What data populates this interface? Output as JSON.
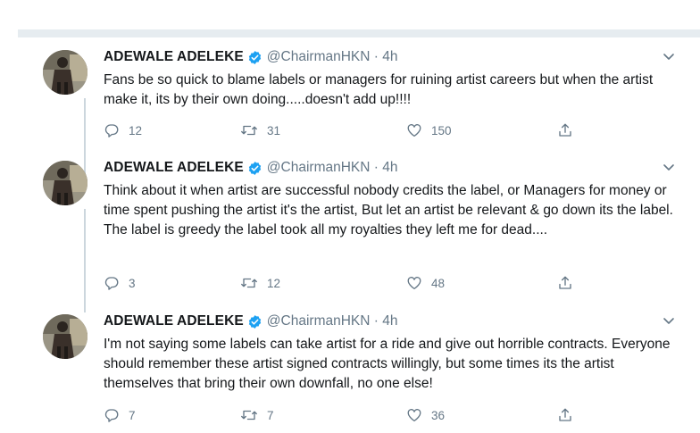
{
  "tweets": [
    {
      "name": "ADEWALE ADELEKE",
      "meta": "@ChairmanHKN · 4h",
      "text": "Fans be so quick to blame labels or managers for ruining artist careers but when the artist make it, its by their own doing.....doesn't add up!!!!",
      "replies": "12",
      "retweets": "31",
      "likes": "150"
    },
    {
      "name": "ADEWALE ADELEKE",
      "meta": "@ChairmanHKN · 4h",
      "text": "Think about it when artist are successful nobody credits the label, or Managers for money or time spent pushing the artist it's the artist, But let an artist be relevant & go down its the label. The label is greedy the label took all my royalties they left me for dead....",
      "replies": "3",
      "retweets": "12",
      "likes": "48"
    },
    {
      "name": "ADEWALE ADELEKE",
      "meta": "@ChairmanHKN · 4h",
      "text": "I'm not saying some labels can take artist for a ride and give out horrible contracts. Everyone should remember these artist signed contracts willingly, but some times its the artist themselves that bring their own downfall, no one else!",
      "replies": "7",
      "retweets": "7",
      "likes": "36"
    }
  ],
  "icons": {
    "verified": "verified-badge-icon",
    "menu": "chevron-down-icon",
    "reply": "reply-icon",
    "retweet": "retweet-icon",
    "like": "heart-icon",
    "share": "share-icon"
  },
  "colors": {
    "verified": "#1da1f2",
    "meta": "#657786",
    "text": "#14171a",
    "thread_line": "#ccd6dd",
    "separator": "#e6ecf0"
  }
}
